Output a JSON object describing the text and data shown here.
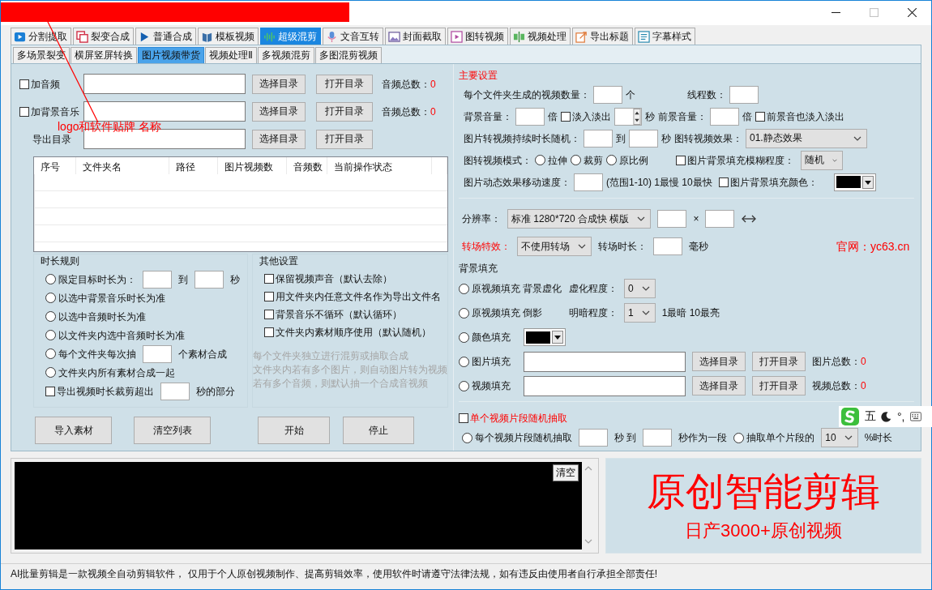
{
  "window": {
    "maximize_disabled": true
  },
  "annotation": {
    "text": "logo和软件贴牌 名称"
  },
  "main_tabs": [
    {
      "label": "分割提取",
      "selected": false
    },
    {
      "label": "裂变合成",
      "selected": false
    },
    {
      "label": "普通合成",
      "selected": false
    },
    {
      "label": "模板视频",
      "selected": false
    },
    {
      "label": "超级混剪",
      "selected": true
    },
    {
      "label": "文音互转",
      "selected": false
    },
    {
      "label": "封面截取",
      "selected": false
    },
    {
      "label": "图转视频",
      "selected": false
    },
    {
      "label": "视频处理",
      "selected": false
    },
    {
      "label": "导出标题",
      "selected": false
    },
    {
      "label": "字幕样式",
      "selected": false
    }
  ],
  "sub_tabs": [
    {
      "label": "多场景裂变",
      "selected": false
    },
    {
      "label": "横屏竖屏转换",
      "selected": false
    },
    {
      "label": "图片视频带货",
      "selected": true
    },
    {
      "label": "视频处理Ⅱ",
      "selected": false
    },
    {
      "label": "多视频混剪",
      "selected": false
    },
    {
      "label": "多图混剪视频",
      "selected": false
    }
  ],
  "file_rows": [
    {
      "items": [
        {
          "kind": "check",
          "label": "加音频",
          "checked": false
        },
        {
          "kind": "path-field"
        },
        {
          "kind": "button",
          "label": "选择目录"
        },
        {
          "kind": "button",
          "label": "打开目录"
        },
        {
          "kind": "count",
          "label": "音频总数：",
          "value": "0"
        }
      ]
    },
    {
      "items": [
        {
          "kind": "check",
          "label": "加背景音乐",
          "checked": false
        },
        {
          "kind": "path-field"
        },
        {
          "kind": "button",
          "label": "选择目录"
        },
        {
          "kind": "button",
          "label": "打开目录"
        },
        {
          "kind": "count",
          "label": "音频总数：",
          "value": "0"
        }
      ]
    },
    {
      "items": [
        {
          "kind": "text",
          "text": "导出目录"
        },
        {
          "kind": "path-field"
        },
        {
          "kind": "button",
          "label": "选择目录"
        },
        {
          "kind": "button",
          "label": "打开目录"
        }
      ]
    }
  ],
  "table": {
    "columns": [
      "序号",
      "文件夹名",
      "路径",
      "图片视频数",
      "音频数",
      "当前操作状态"
    ]
  },
  "duration_rules": {
    "title": "时长规则",
    "rows": [
      {
        "items": [
          {
            "kind": "radio",
            "label": "限定目标时长为：",
            "selected": false
          },
          {
            "kind": "number-field"
          },
          {
            "kind": "text",
            "text": "到"
          },
          {
            "kind": "number-field"
          },
          {
            "kind": "text",
            "text": "秒"
          }
        ]
      },
      {
        "items": [
          {
            "kind": "radio",
            "label": "以选中背景音乐时长为准",
            "selected": false
          }
        ]
      },
      {
        "items": [
          {
            "kind": "radio",
            "label": "以选中音频时长为准",
            "selected": false
          }
        ]
      },
      {
        "items": [
          {
            "kind": "radio",
            "label": "以文件夹内选中音频时长为准",
            "selected": false
          }
        ]
      },
      {
        "items": [
          {
            "kind": "radio",
            "label": "每个文件夹每次抽",
            "selected": false
          },
          {
            "kind": "number-field"
          },
          {
            "kind": "text",
            "text": "个素材合成"
          }
        ]
      },
      {
        "items": [
          {
            "kind": "radio",
            "label": "文件夹内所有素材合成一起",
            "selected": false
          }
        ]
      },
      {
        "items": [
          {
            "kind": "check",
            "label": "导出视频时长裁剪超出",
            "checked": false
          },
          {
            "kind": "number-field"
          },
          {
            "kind": "text",
            "text": "秒的部分"
          }
        ]
      }
    ]
  },
  "other_settings": {
    "title": "其他设置",
    "rows": [
      {
        "items": [
          {
            "kind": "check",
            "label": "保留视频声音（默认去除）",
            "checked": false
          }
        ]
      },
      {
        "items": [
          {
            "kind": "check",
            "label": "用文件夹内任意文件名作为导出文件名",
            "checked": false
          }
        ]
      },
      {
        "items": [
          {
            "kind": "check",
            "label": "背景音乐不循环（默认循环）",
            "checked": false
          }
        ]
      },
      {
        "items": [
          {
            "kind": "check",
            "label": "文件夹内素材顺序使用（默认随机）",
            "checked": false
          }
        ]
      }
    ],
    "notes": [
      "每个文件夹独立进行混剪或抽取合成",
      "文件夹内若有多个图片，则自动图片转为视频",
      "若有多个音频，则默认抽一个合成音视频"
    ]
  },
  "action_buttons": [
    "导入素材",
    "清空列表",
    "开始",
    "停止"
  ],
  "main_settings": {
    "title": "主要设置",
    "rows": [
      {
        "items": [
          {
            "kind": "text",
            "text": "每个文件夹生成的视频数量："
          },
          {
            "kind": "number-field"
          },
          {
            "kind": "text",
            "text": "个"
          },
          {
            "kind": "text",
            "text": "线程数："
          },
          {
            "kind": "number-field"
          }
        ]
      },
      {
        "items": [
          {
            "kind": "text",
            "text": "背景音量："
          },
          {
            "kind": "number-field"
          },
          {
            "kind": "text",
            "text": "倍"
          },
          {
            "kind": "check",
            "label": "淡入淡出",
            "checked": false
          },
          {
            "kind": "spin"
          },
          {
            "kind": "text",
            "text": "秒"
          },
          {
            "kind": "text",
            "text": "前景音量："
          },
          {
            "kind": "number-field"
          },
          {
            "kind": "text",
            "text": "倍"
          },
          {
            "kind": "check",
            "label": "前景音也淡入淡出",
            "checked": false
          }
        ]
      },
      {
        "items": [
          {
            "kind": "text",
            "text": "图片转视频持续时长随机："
          },
          {
            "kind": "number-field"
          },
          {
            "kind": "text",
            "text": "到"
          },
          {
            "kind": "number-field"
          },
          {
            "kind": "text",
            "text": "秒"
          },
          {
            "kind": "text",
            "text": "图转视频效果："
          },
          {
            "kind": "dropdown",
            "value": "01.静态效果"
          }
        ]
      },
      {
        "items": [
          {
            "kind": "text",
            "text": "图转视频模式："
          },
          {
            "kind": "radio",
            "label": "拉伸",
            "selected": false
          },
          {
            "kind": "radio",
            "label": "裁剪",
            "selected": false
          },
          {
            "kind": "radio",
            "label": "原比例",
            "selected": false
          },
          {
            "kind": "check",
            "label": "图片背景填充模糊程度：",
            "checked": false
          },
          {
            "kind": "dropdown",
            "value": "随机"
          }
        ]
      },
      {
        "items": [
          {
            "kind": "text",
            "text": "图片动态效果移动速度："
          },
          {
            "kind": "number-field"
          },
          {
            "kind": "text",
            "text": "(范围1-10)  1最慢 10最快"
          },
          {
            "kind": "check",
            "label": "图片背景填充颜色：",
            "checked": false
          },
          {
            "kind": "color",
            "color": "#000000"
          }
        ]
      }
    ]
  },
  "output_settings": {
    "rows": [
      {
        "items": [
          {
            "kind": "text",
            "text": "分辨率："
          },
          {
            "kind": "dropdown",
            "value": "标准 1280*720 合成快 横版"
          },
          {
            "kind": "number-field"
          },
          {
            "kind": "text",
            "text": "×"
          },
          {
            "kind": "number-field"
          },
          {
            "kind": "swap-icon"
          }
        ]
      },
      {
        "items": [
          {
            "kind": "accent",
            "text": "转场特效："
          },
          {
            "kind": "dropdown",
            "value": "不使用转场"
          },
          {
            "kind": "text",
            "text": "转场时长："
          },
          {
            "kind": "number-field"
          },
          {
            "kind": "text",
            "text": "毫秒"
          },
          {
            "kind": "accent",
            "text": "官网：yc63.cn"
          }
        ]
      }
    ]
  },
  "background_fill": {
    "title": "背景填充",
    "rows": [
      {
        "items": [
          {
            "kind": "radio",
            "label": "原视频填充 背景虚化",
            "selected": false
          },
          {
            "kind": "text",
            "text": "虚化程度："
          },
          {
            "kind": "dropdown",
            "value": "0"
          }
        ]
      },
      {
        "items": [
          {
            "kind": "radio",
            "label": "原视频填充 倒影",
            "selected": false
          },
          {
            "kind": "text",
            "text": "明暗程度："
          },
          {
            "kind": "dropdown",
            "value": "1"
          },
          {
            "kind": "text",
            "text": "1最暗 10最亮"
          }
        ]
      },
      {
        "items": [
          {
            "kind": "radio",
            "label": "颜色填充",
            "selected": false
          },
          {
            "kind": "color",
            "color": "#000000"
          }
        ]
      },
      {
        "items": [
          {
            "kind": "radio",
            "label": "图片填充",
            "selected": false
          },
          {
            "kind": "path-field"
          },
          {
            "kind": "button",
            "label": "选择目录"
          },
          {
            "kind": "button",
            "label": "打开目录"
          },
          {
            "kind": "count",
            "label": "图片总数：",
            "value": "0"
          }
        ]
      },
      {
        "items": [
          {
            "kind": "radio",
            "label": "视频填充",
            "selected": false
          },
          {
            "kind": "path-field"
          },
          {
            "kind": "button",
            "label": "选择目录"
          },
          {
            "kind": "button",
            "label": "打开目录"
          },
          {
            "kind": "count",
            "label": "视频总数：",
            "value": "0"
          }
        ]
      }
    ]
  },
  "clip_extract": {
    "rows": [
      {
        "items": [
          {
            "kind": "accent-check",
            "label": "单个视频片段随机抽取",
            "checked": false
          }
        ]
      },
      {
        "items": [
          {
            "kind": "radio",
            "label": "每个视频片段随机抽取",
            "selected": false
          },
          {
            "kind": "number-field"
          },
          {
            "kind": "text",
            "text": "秒 到"
          },
          {
            "kind": "number-field"
          },
          {
            "kind": "text",
            "text": "秒作为一段"
          },
          {
            "kind": "radio",
            "label": "抽取单个片段的",
            "selected": false
          },
          {
            "kind": "dropdown",
            "value": "10"
          },
          {
            "kind": "text",
            "text": "%时长"
          }
        ]
      }
    ]
  },
  "log": {
    "clear_button": "清空"
  },
  "promo": {
    "headline": "原创智能剪辑",
    "subline": "日产3000+原创视频"
  },
  "status_bar": "AI批量剪辑是一款视频全自动剪辑软件， 仅用于个人原创视频制作、提高剪辑效率，使用软件时请遵守法律法规，如有违反由使用者自行承担全部责任!",
  "ime_toolbar": {
    "mode": "五",
    "punctuation": "°,"
  }
}
